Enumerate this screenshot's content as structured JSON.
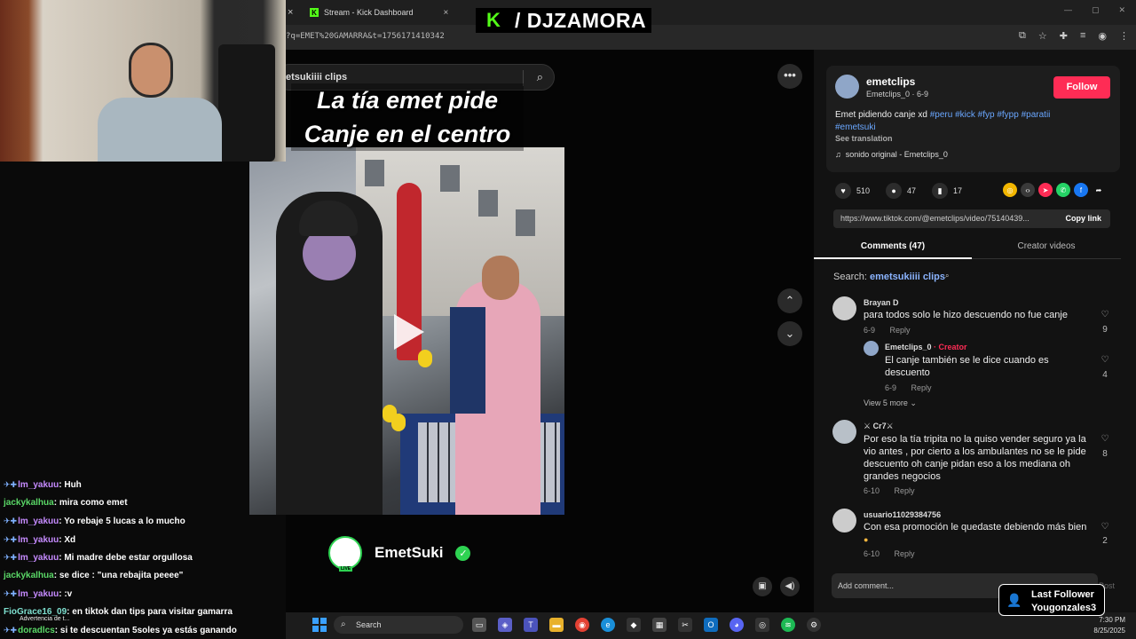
{
  "browser": {
    "tab_active_close": "×",
    "tab_kick_label": "Stream - Kick Dashboard",
    "tab_close": "×",
    "url": "?q=EMET%20GAMARRA&t=1756171410342"
  },
  "overlay": {
    "brand_letter": "K",
    "brand_name": "/ DJZAMORA",
    "last_follower_title": "Last Follower",
    "last_follower_name": "Yougonzales3",
    "warning_text": "Advertencia de t..."
  },
  "search": {
    "query": "etsukiiii clips"
  },
  "video": {
    "caption_line1": "La tía emet pide",
    "caption_line2": "Canje en el centro",
    "creator_name": "EmetSuki",
    "live_badge": "LIVE"
  },
  "post": {
    "username": "emetclips",
    "subline": "Emetclips_0 · 6-9",
    "follow_label": "Follow",
    "description": "Emet pidiendo canje xd",
    "hashtags_line1": "#peru #kick #fyp #fypp #paratii",
    "hashtags_line2": "#emetsuki",
    "see_translation": "See translation",
    "sound": "sonido original - Emetclips_0",
    "likes": "510",
    "comments": "47",
    "saves": "17",
    "link": "https://www.tiktok.com/@emetclips/video/75140439...",
    "copy_link": "Copy link"
  },
  "tabs": {
    "comments": "Comments (47)",
    "creator_videos": "Creator videos"
  },
  "comment_search": {
    "label": "Search:",
    "term": "emetsukiiii clips"
  },
  "comments": [
    {
      "user": "Brayan D",
      "text": "para todos solo le hizo descuendo no fue canje",
      "date": "6-9",
      "reply": "Reply",
      "likes": "9"
    },
    {
      "user": "Emetclips_0",
      "creator_tag": "· Creator",
      "text1": "El canje también se le dice cuando es",
      "text2": "descuento",
      "date": "6-9",
      "reply": "Reply",
      "likes": "4"
    },
    {
      "view_more": "View 5 more"
    },
    {
      "user": "⚔ Cr7⚔",
      "text1": "Por eso la tía tripita no la quiso vender seguro ya la",
      "text2": "vio antes , por cierto a los ambulantes no se le pide",
      "text3": "descuento oh canje pidan eso a los mediana oh",
      "text4": "grandes negocios",
      "date": "6-10",
      "reply": "Reply",
      "likes": "8"
    },
    {
      "user": "usuario11029384756",
      "text1": "Con esa promoción le quedaste debiendo más bien",
      "date": "6-10",
      "reply": "Reply",
      "likes": "2"
    }
  ],
  "add_comment": {
    "placeholder": "Add comment...",
    "post_label": "Post"
  },
  "chat": [
    {
      "name": "lm_yakuu",
      "text": "Huh"
    },
    {
      "name": "jackykalhua",
      "text": "mira como emet"
    },
    {
      "name": "lm_yakuu",
      "text": "Yo rebaje 5 lucas a lo mucho"
    },
    {
      "name": "lm_yakuu",
      "text": "Xd"
    },
    {
      "name": "lm_yakuu",
      "text": "Mi madre debe estar orgullosa"
    },
    {
      "name": "jackykalhua",
      "text": "se dice : \"una rebajita peeee\""
    },
    {
      "name": "lm_yakuu",
      "text": ":v"
    },
    {
      "name": "FioGrace16_09",
      "text": "en tiktok dan tips para visitar gamarra"
    },
    {
      "name": "doradlcs",
      "text": "si te descuentan 5soles ya estás ganando"
    }
  ],
  "taskbar": {
    "search_label": "Search",
    "time": "7:30 PM",
    "date": "8/25/2025"
  },
  "colors": {
    "kick_green": "#53fc18",
    "follow_red": "#fe2c55",
    "hashtag_blue": "#6aa7ff"
  }
}
